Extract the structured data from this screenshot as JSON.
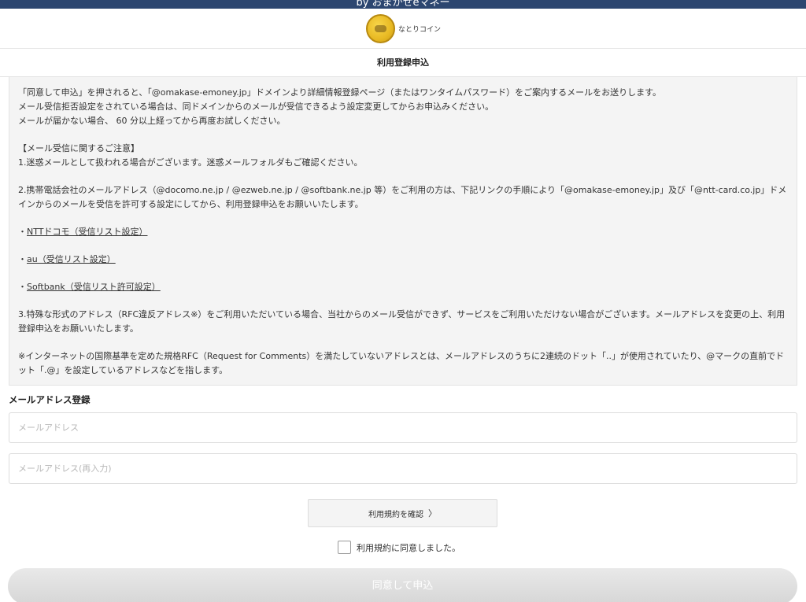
{
  "header": {
    "top_text": "by おまかせeマネー",
    "brand_name": "なとりコイン",
    "page_title": "利用登録申込"
  },
  "notice": {
    "intro_1": "「同意して申込」を押されると、「@omakase-emoney.jp」ドメインより詳細情報登録ページ（またはワンタイムパスワード）をご案内するメールをお送りします。",
    "intro_2": "メール受信拒否設定をされている場合は、同ドメインからのメールが受信できるよう設定変更してからお申込みください。",
    "intro_3": "メールが届かない場合、 60 分以上経ってから再度お試しください。",
    "caution_heading": "【メール受信に関するご注意】",
    "item_1": "1.迷惑メールとして扱われる場合がございます。迷惑メールフォルダもご確認ください。",
    "item_2": "2.携帯電話会社のメールアドレス（@docomo.ne.jp / @ezweb.ne.jp / @softbank.ne.jp 等）をご利用の方は、下記リンクの手順により「@omakase-emoney.jp」及び「@ntt-card.co.jp」ドメインからのメールを受信を許可する設定にしてから、利用登録申込をお願いいたします。",
    "bullet": "・",
    "links": [
      "NTTドコモ（受信リスト設定）",
      "au（受信リスト設定）",
      "Softbank（受信リスト許可設定）"
    ],
    "item_3": "3.特殊な形式のアドレス（RFC違反アドレス※）をご利用いただいている場合、当社からのメール受信ができず、サービスをご利用いただけない場合がございます。メールアドレスを変更の上、利用登録申込をお願いいたします。",
    "footnote": "※インターネットの国際基準を定めた規格RFC（Request for Comments）を満たしていないアドレスとは、メールアドレスのうちに2連続のドット「..」が使用されていたり、@マークの直前でドット「.@」を設定しているアドレスなどを指します。"
  },
  "form": {
    "section_label": "メールアドレス登録",
    "email_placeholder": "メールアドレス",
    "email_confirm_placeholder": "メールアドレス(再入力)",
    "email_value": "",
    "email_confirm_value": "",
    "terms_button": "利用規約を確認",
    "terms_chevron": "〉",
    "agree_label": "利用規約に同意しました。",
    "agree_checked": false,
    "submit_label": "同意して申込"
  },
  "colors": {
    "top_bar": "#2c4670",
    "notice_bg": "#f4f4f4",
    "submit_disabled": "#dcdcdc",
    "coin": "#e8b923"
  },
  "icons": {
    "brand_logo": "gold-coin-logo-icon",
    "chevron": "chevron-right-icon",
    "checkbox": "checkbox-unchecked-icon"
  }
}
